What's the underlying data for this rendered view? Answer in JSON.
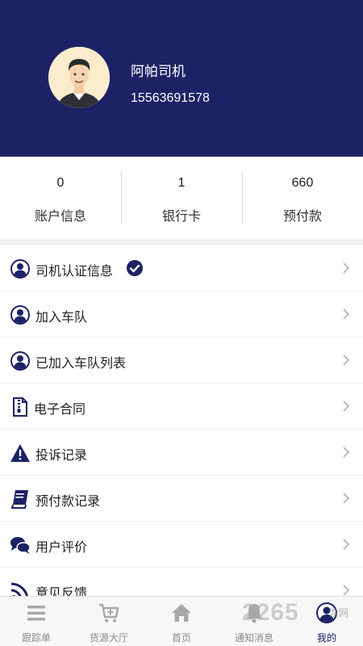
{
  "profile": {
    "name": "阿帕司机",
    "phone": "15563691578"
  },
  "stats": [
    {
      "value": "0",
      "label": "账户信息"
    },
    {
      "value": "1",
      "label": "银行卡"
    },
    {
      "value": "660",
      "label": "预付款"
    }
  ],
  "menu": [
    {
      "label": "司机认证信息",
      "icon": "user-circle-icon",
      "verified": true
    },
    {
      "label": "加入车队",
      "icon": "user-circle-icon"
    },
    {
      "label": "已加入车队列表",
      "icon": "user-circle-icon"
    },
    {
      "label": "电子合同",
      "icon": "zip-document-icon"
    },
    {
      "label": "投诉记录",
      "icon": "warning-icon"
    },
    {
      "label": "预付款记录",
      "icon": "book-icon"
    },
    {
      "label": "用户评价",
      "icon": "chat-bubbles-icon"
    },
    {
      "label": "意见反馈",
      "icon": "rss-icon"
    }
  ],
  "nav": [
    {
      "label": "跟踪单",
      "icon": "list-icon"
    },
    {
      "label": "货源大厅",
      "icon": "cart-plus-icon"
    },
    {
      "label": "首页",
      "icon": "home-icon"
    },
    {
      "label": "通知消息",
      "icon": "bell-icon"
    },
    {
      "label": "我的",
      "icon": "user-icon",
      "active": true
    }
  ],
  "watermark": {
    "brand": "2265",
    "sub": "游网"
  },
  "colors": {
    "primary": "#1d2266",
    "background": "#ffffff",
    "divider": "#f0f0f0"
  }
}
